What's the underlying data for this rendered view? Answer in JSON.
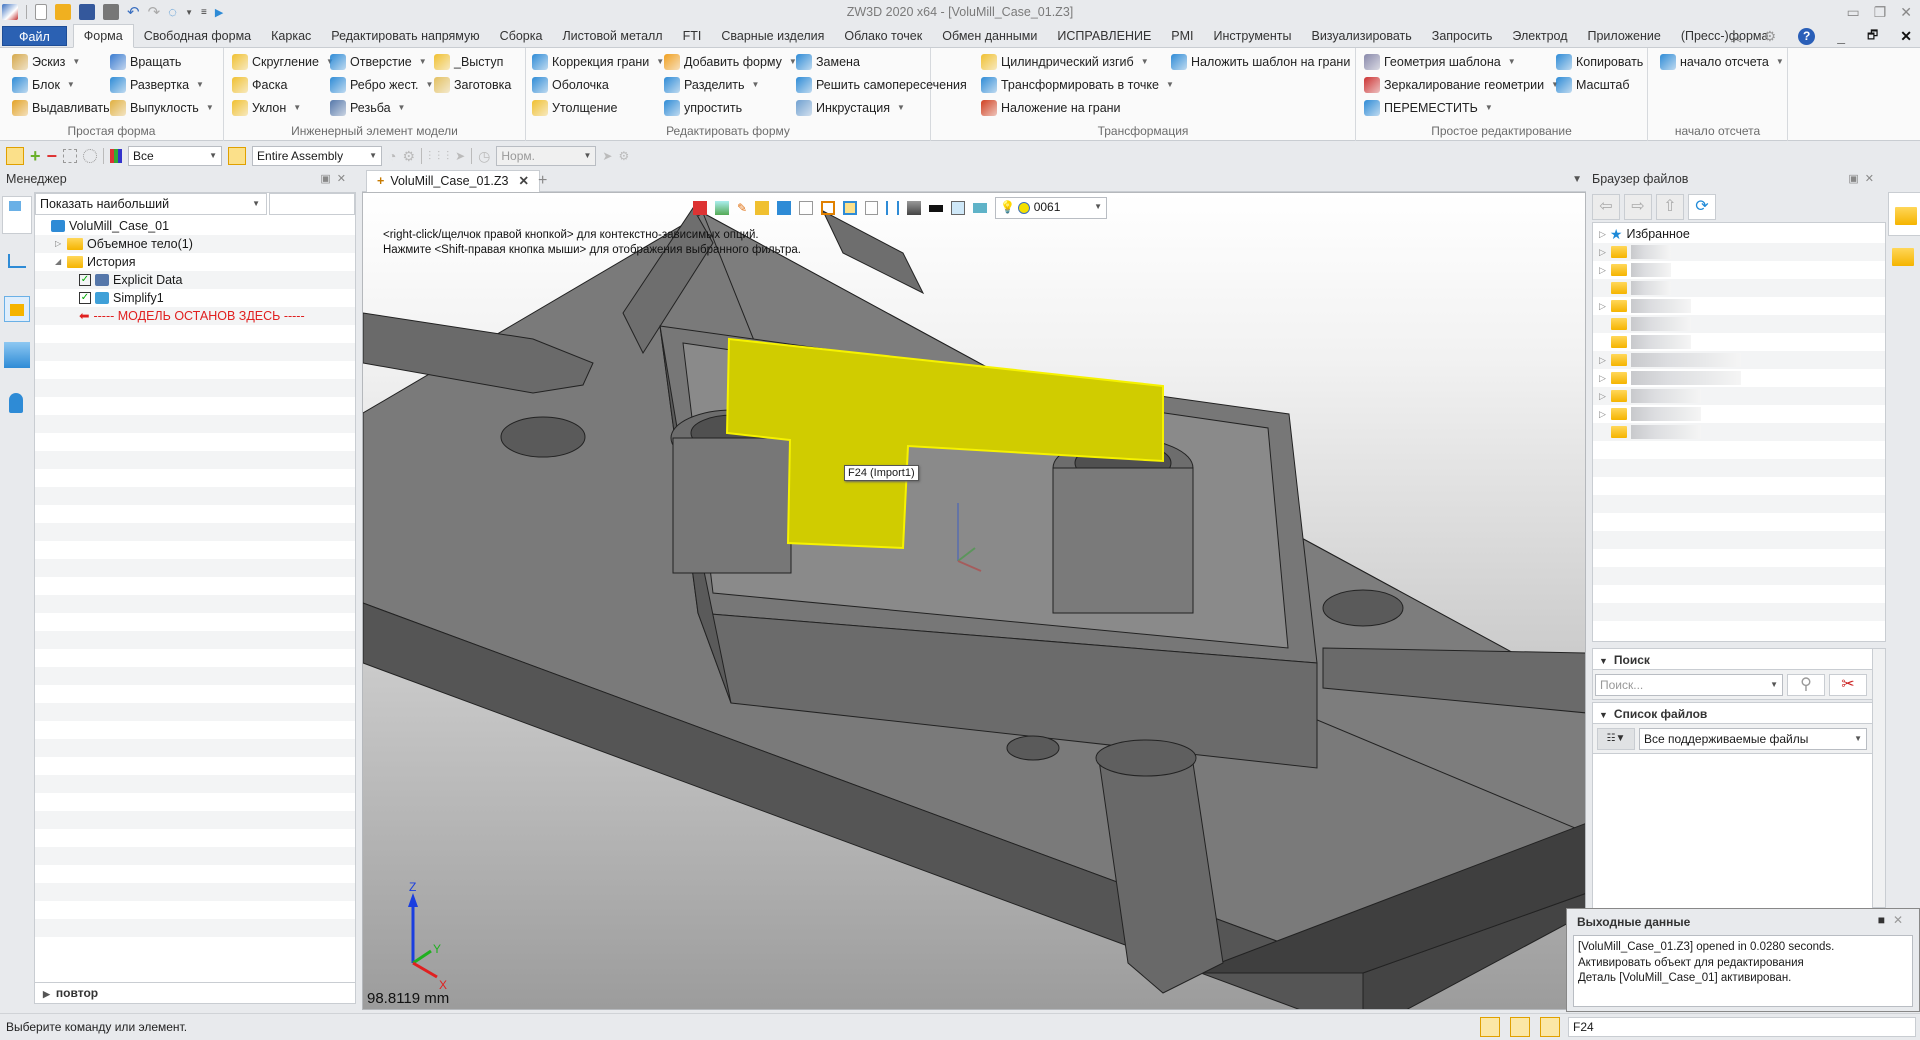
{
  "window": {
    "title": "ZW3D 2020 x64 - [VoluMill_Case_01.Z3]"
  },
  "quick_access": {
    "icons": [
      "app-logo-icon",
      "new-file-icon",
      "open-file-icon",
      "save-icon",
      "print-icon",
      "undo-icon",
      "redo-icon",
      "view-refresh-icon",
      "customize-icon",
      "run-icon"
    ]
  },
  "menu_tabs": [
    "Файл",
    "Форма",
    "Свободная форма",
    "Каркас",
    "Редактировать напрямую",
    "Сборка",
    "Листовой металл",
    "FTI",
    "Сварные изделия",
    "Облако точек",
    "Обмен данными",
    "ИСПРАВЛЕНИЕ",
    "PMI",
    "Инструменты",
    "Визуализировать",
    "Запросить",
    "Электрод",
    "Приложение",
    "(Пресс-)форма"
  ],
  "active_tab": "Форма",
  "ribbon": {
    "groups": [
      {
        "label": "Простая форма",
        "items": [
          {
            "label": "Эскиз",
            "dropdown": true,
            "icon": "sketch-icon",
            "color": "#d5a84b"
          },
          {
            "label": "Блок",
            "dropdown": true,
            "icon": "block-icon",
            "color": "#2e8bd6"
          },
          {
            "label": "Выдавливать",
            "dropdown": false,
            "icon": "extrude-icon",
            "color": "#e3a225"
          },
          {
            "label": "Вращать",
            "dropdown": false,
            "icon": "revolve-icon",
            "color": "#3a7bd0"
          },
          {
            "label": "Развертка",
            "dropdown": true,
            "icon": "sweep-icon",
            "color": "#2e8bd6"
          },
          {
            "label": "Выпуклость",
            "dropdown": true,
            "icon": "loft-icon",
            "color": "#e0b040"
          }
        ]
      },
      {
        "label": "Инженерный элемент модели",
        "items": [
          {
            "label": "Скругление",
            "dropdown": true,
            "icon": "fillet-icon",
            "color": "#f0c030"
          },
          {
            "label": "Фаска",
            "dropdown": false,
            "icon": "chamfer-icon",
            "color": "#f0c030"
          },
          {
            "label": "Уклон",
            "dropdown": true,
            "icon": "draft-icon",
            "color": "#f0c030"
          },
          {
            "label": "Отверстие",
            "dropdown": true,
            "icon": "hole-icon",
            "color": "#2e8bd6"
          },
          {
            "label": "Ребро жест.",
            "dropdown": true,
            "icon": "rib-icon",
            "color": "#2e8bd6"
          },
          {
            "label": "Резьба",
            "dropdown": true,
            "icon": "thread-icon",
            "color": "#5577aa"
          },
          {
            "label": "_Выступ",
            "dropdown": false,
            "icon": "lip-icon",
            "color": "#f0c030"
          },
          {
            "label": "Заготовка",
            "dropdown": false,
            "icon": "stock-icon",
            "color": "#e3c060"
          }
        ]
      },
      {
        "label": "Редактировать форму",
        "items": [
          {
            "label": "Коррекция грани",
            "dropdown": true,
            "icon": "face-offset-icon",
            "color": "#2e8bd6"
          },
          {
            "label": "Оболочка",
            "dropdown": false,
            "icon": "shell-icon",
            "color": "#2e8bd6"
          },
          {
            "label": "Утолщение",
            "dropdown": false,
            "icon": "thicken-icon",
            "color": "#f0c030"
          },
          {
            "label": "Добавить форму",
            "dropdown": true,
            "icon": "add-shape-icon",
            "color": "#f0a020"
          },
          {
            "label": "Разделить",
            "dropdown": true,
            "icon": "divide-icon",
            "color": "#2e8bd6"
          },
          {
            "label": "упростить",
            "dropdown": false,
            "icon": "simplify-icon",
            "color": "#2e8bd6"
          },
          {
            "label": "Замена",
            "dropdown": false,
            "icon": "replace-icon",
            "color": "#2e8bd6"
          },
          {
            "label": "Решить самопересечения",
            "dropdown": false,
            "icon": "self-intersect-icon",
            "color": "#2e8bd6"
          },
          {
            "label": "Инкрустация",
            "dropdown": true,
            "icon": "emboss-icon",
            "color": "#6fa0d0"
          }
        ]
      },
      {
        "label": "Трансформация",
        "items": [
          {
            "label": "Цилиндрический изгиб",
            "dropdown": true,
            "icon": "cylinder-bend-icon",
            "color": "#f0c030"
          },
          {
            "label": "Трансформировать в точке",
            "dropdown": true,
            "icon": "point-deform-icon",
            "color": "#2e8bd6"
          },
          {
            "label": "Наложение на грани",
            "dropdown": false,
            "icon": "wrap-icon",
            "color": "#d04020"
          },
          {
            "label": "Наложить шаблон на грани",
            "dropdown": false,
            "icon": "wrap-pattern-icon",
            "color": "#2e8bd6"
          }
        ]
      },
      {
        "label": "Простое редактирование",
        "items": [
          {
            "label": "Геометрия шаблона",
            "dropdown": true,
            "icon": "pattern-icon",
            "color": "#88a"
          },
          {
            "label": "Зеркалирование геометрии",
            "dropdown": true,
            "icon": "mirror-icon",
            "color": "#c33"
          },
          {
            "label": "ПЕРЕМЕСТИТЬ",
            "dropdown": true,
            "icon": "move-icon",
            "color": "#2e8bd6"
          },
          {
            "label": "Копировать",
            "dropdown": false,
            "icon": "copy-icon",
            "color": "#2e8bd6"
          },
          {
            "label": "Масштаб",
            "dropdown": false,
            "icon": "scale-icon",
            "color": "#2e8bd6"
          }
        ]
      },
      {
        "label": "начало отсчета",
        "items": [
          {
            "label": "начало отсчета",
            "dropdown": true,
            "icon": "datum-icon",
            "color": "#2e8bd6"
          }
        ]
      }
    ]
  },
  "toolbar": {
    "filter_value": "Все",
    "scope_value": "Entire Assembly",
    "mode_value": "Норм."
  },
  "manager": {
    "title": "Менеджер",
    "filter_value": "Показать наибольший",
    "tree": [
      {
        "label": "VoluMill_Case_01",
        "indent": 0,
        "icon": "assembly-icon",
        "expander": ""
      },
      {
        "label": "Объемное тело(1)",
        "indent": 1,
        "icon": "folder-icon",
        "expander": "▷"
      },
      {
        "label": "История",
        "indent": 1,
        "icon": "folder-open-icon",
        "expander": "◢"
      },
      {
        "label": "Explicit Data",
        "indent": 2,
        "icon": "explicit-data-icon",
        "checked": true
      },
      {
        "label": "Simplify1",
        "indent": 2,
        "icon": "simplify-icon",
        "checked": true
      },
      {
        "label": "----- МОДЕЛЬ ОСТАНОВ ЗДЕСЬ -----",
        "indent": 2,
        "icon": "stop-arrow-icon",
        "marker": true
      }
    ],
    "repeat_section": "повтор"
  },
  "document": {
    "tab_label": "VoluMill_Case_01.Z3",
    "hint_line1": "<right-click/щелчок правой кнопкой> для контекстно-зависимых опций.",
    "hint_line2": "Нажмите <Shift-правая кнопка мыши> для отображения выбранного фильтра.",
    "layer_value": "0061",
    "scale_readout": "98.8119 mm",
    "tooltip": "F24 (Import1)",
    "highlight_color": "#d0cc00",
    "axis_labels": {
      "x": "X",
      "y": "Y",
      "z": "Z"
    }
  },
  "file_browser": {
    "title": "Браузер файлов",
    "favorites_label": "Избранное",
    "folder_count": 11,
    "search_section": "Поиск",
    "search_placeholder": "Поиск...",
    "file_list_section": "Список файлов",
    "file_filter_value": "Все поддерживаемые файлы"
  },
  "output": {
    "title": "Выходные данные",
    "lines": [
      "[VoluMill_Case_01.Z3] opened in 0.0280 seconds.",
      "Активировать объект для редактирования",
      "Деталь [VoluMill_Case_01] активирован."
    ]
  },
  "status": {
    "message": "Выберите команду или элемент.",
    "command_input": "F24"
  }
}
